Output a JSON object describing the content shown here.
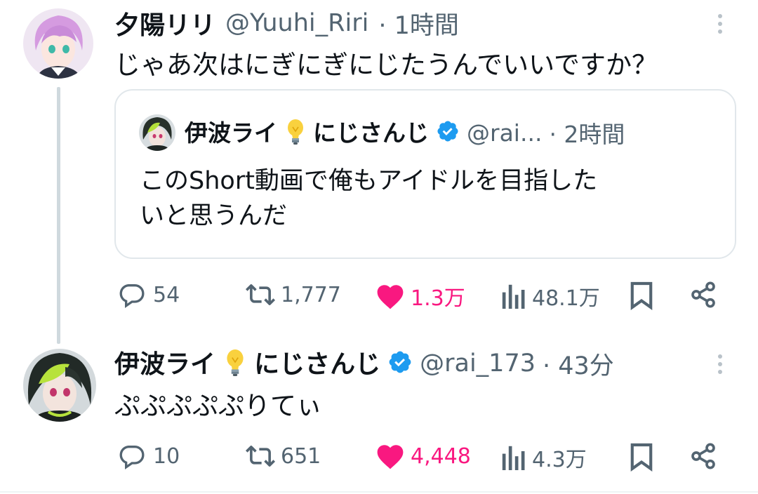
{
  "colors": {
    "accent_like": "#f91880",
    "muted": "#536471",
    "verified": "#1d9bf0",
    "border": "#e1e7eb"
  },
  "tweet1": {
    "name": "夕陽リリ",
    "handle": "@Yuuhi_Riri",
    "time": "· 1時間",
    "text": "じゃあ次はにぎにぎにじたうんでいいですか？",
    "quote": {
      "name_prefix": "伊波ライ",
      "name_suffix": "にじさんじ",
      "handle": "@rai...",
      "time": "· 2時間",
      "text_line1": "このShort動画で俺もアイドルを目指した",
      "text_line2": "いと思うんだ"
    },
    "actions": {
      "replies": "54",
      "retweets": "1,777",
      "likes": "1.3万",
      "views": "48.1万"
    }
  },
  "tweet2": {
    "name_prefix": "伊波ライ",
    "name_suffix": "にじさんじ",
    "handle": "@rai_173",
    "time": "· 43分",
    "text": "ぷぷぷぷぷりてぃ",
    "actions": {
      "replies": "10",
      "retweets": "651",
      "likes": "4,448",
      "views": "4.3万"
    }
  },
  "icons": [
    "reply-icon",
    "retweet-icon",
    "like-icon",
    "views-icon",
    "bookmark-icon",
    "share-icon",
    "more-icon",
    "verified-icon",
    "lightbulb-icon"
  ]
}
